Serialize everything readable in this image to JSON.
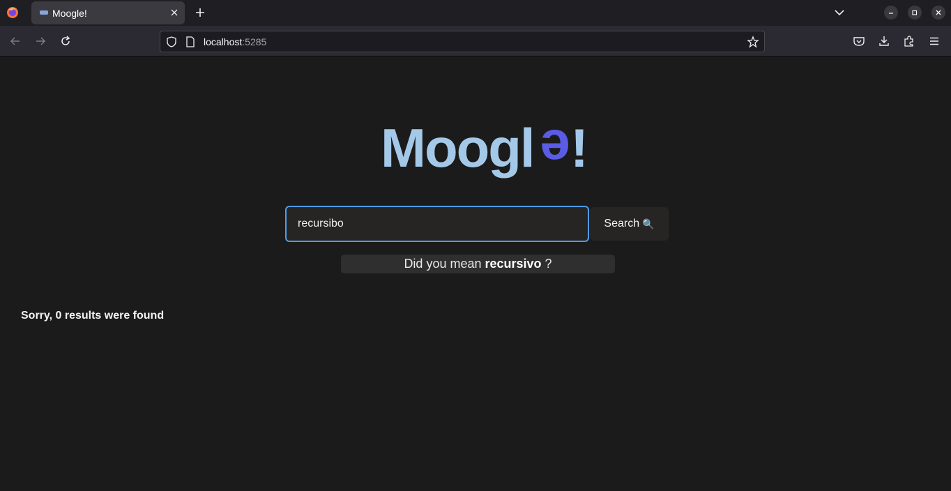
{
  "tab": {
    "title": "Moogle!"
  },
  "url": {
    "host": "localhost",
    "port": ":5285"
  },
  "logo": {
    "text_main": "Moogl",
    "text_accent": "e",
    "text_bang": "!",
    "color_main": "#a4c8e8",
    "color_accent": "#5b5ce6"
  },
  "search": {
    "value": "recursibo",
    "button_label": "Search",
    "button_icon": "🔍"
  },
  "suggestion": {
    "prefix": "Did you mean",
    "word": "recursivo",
    "suffix": "?"
  },
  "results": {
    "message": "Sorry, 0 results were found"
  }
}
